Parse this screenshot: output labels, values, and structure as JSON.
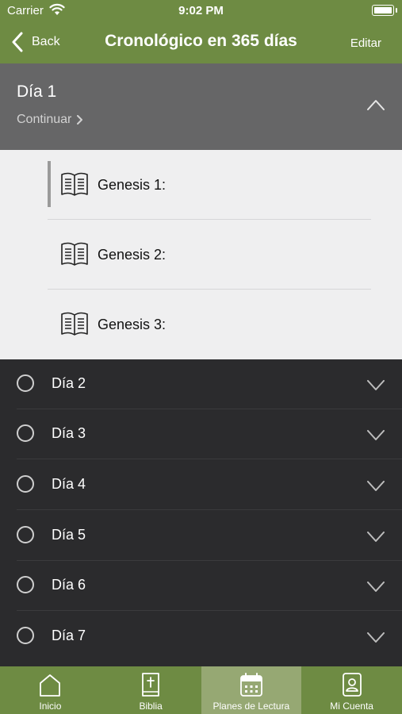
{
  "status": {
    "carrier": "Carrier",
    "time": "9:02 PM"
  },
  "nav": {
    "back_label": "Back",
    "title": "Cronológico en 365 días",
    "edit_label": "Editar"
  },
  "day1": {
    "title": "Día 1",
    "continue_label": "Continuar",
    "readings": [
      {
        "label": "Genesis 1:"
      },
      {
        "label": "Genesis 2:"
      },
      {
        "label": "Genesis 3:"
      }
    ]
  },
  "days": [
    {
      "label": "Día 2"
    },
    {
      "label": "Día 3"
    },
    {
      "label": "Día 4"
    },
    {
      "label": "Día 5"
    },
    {
      "label": "Día 6"
    },
    {
      "label": "Día 7"
    }
  ],
  "tabs": [
    {
      "label": "Inicio",
      "icon": "home-icon"
    },
    {
      "label": "Biblia",
      "icon": "bible-icon"
    },
    {
      "label": "Planes de Lectura",
      "icon": "calendar-icon",
      "active": true
    },
    {
      "label": "Mi Cuenta",
      "icon": "account-icon"
    }
  ],
  "colors": {
    "brand": "#6e8b43",
    "active_tab": "#96a873",
    "list_bg": "#2b2b2d",
    "header_bg": "#666667"
  }
}
